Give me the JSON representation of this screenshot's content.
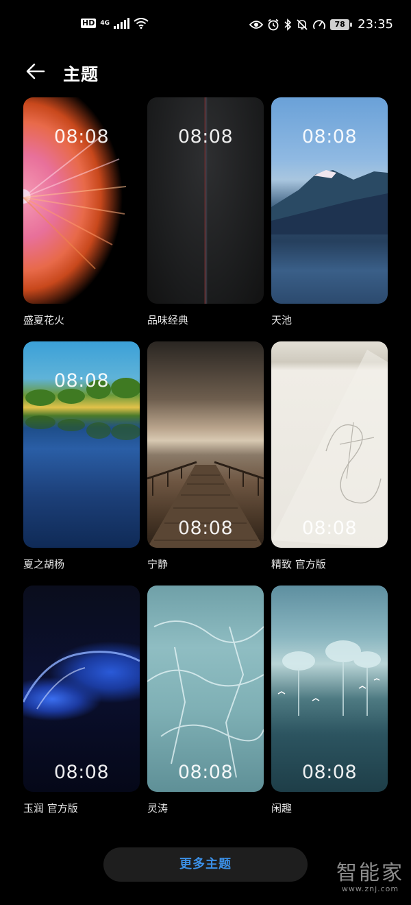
{
  "status_bar": {
    "network_badge": "HD",
    "network_type": "4G",
    "battery_level": "78",
    "time": "23:35",
    "icons": [
      "hd-icon",
      "signal-icon",
      "wifi-icon",
      "eye-icon",
      "alarm-icon",
      "bluetooth-icon",
      "mute-icon",
      "speed-icon",
      "battery-icon"
    ]
  },
  "header": {
    "title": "主题",
    "back_icon": "back-arrow-icon"
  },
  "themes": [
    {
      "name": "盛夏花火",
      "clock": "08:08"
    },
    {
      "name": "品味经典",
      "clock": "08:08"
    },
    {
      "name": "天池",
      "clock": "08:08"
    },
    {
      "name": "夏之胡杨",
      "clock": "08:08"
    },
    {
      "name": "宁静",
      "clock": "08:08"
    },
    {
      "name": "精致 官方版",
      "clock": "08:08"
    },
    {
      "name": "玉润 官方版",
      "clock": "08:08"
    },
    {
      "name": "灵涛",
      "clock": "08:08"
    },
    {
      "name": "闲趣",
      "clock": "08:08"
    }
  ],
  "more_button": "更多主题",
  "watermark": {
    "main": "智能家",
    "sub": "www.znj.com"
  },
  "colors": {
    "accent": "#3b8fe6",
    "background": "#000000"
  }
}
